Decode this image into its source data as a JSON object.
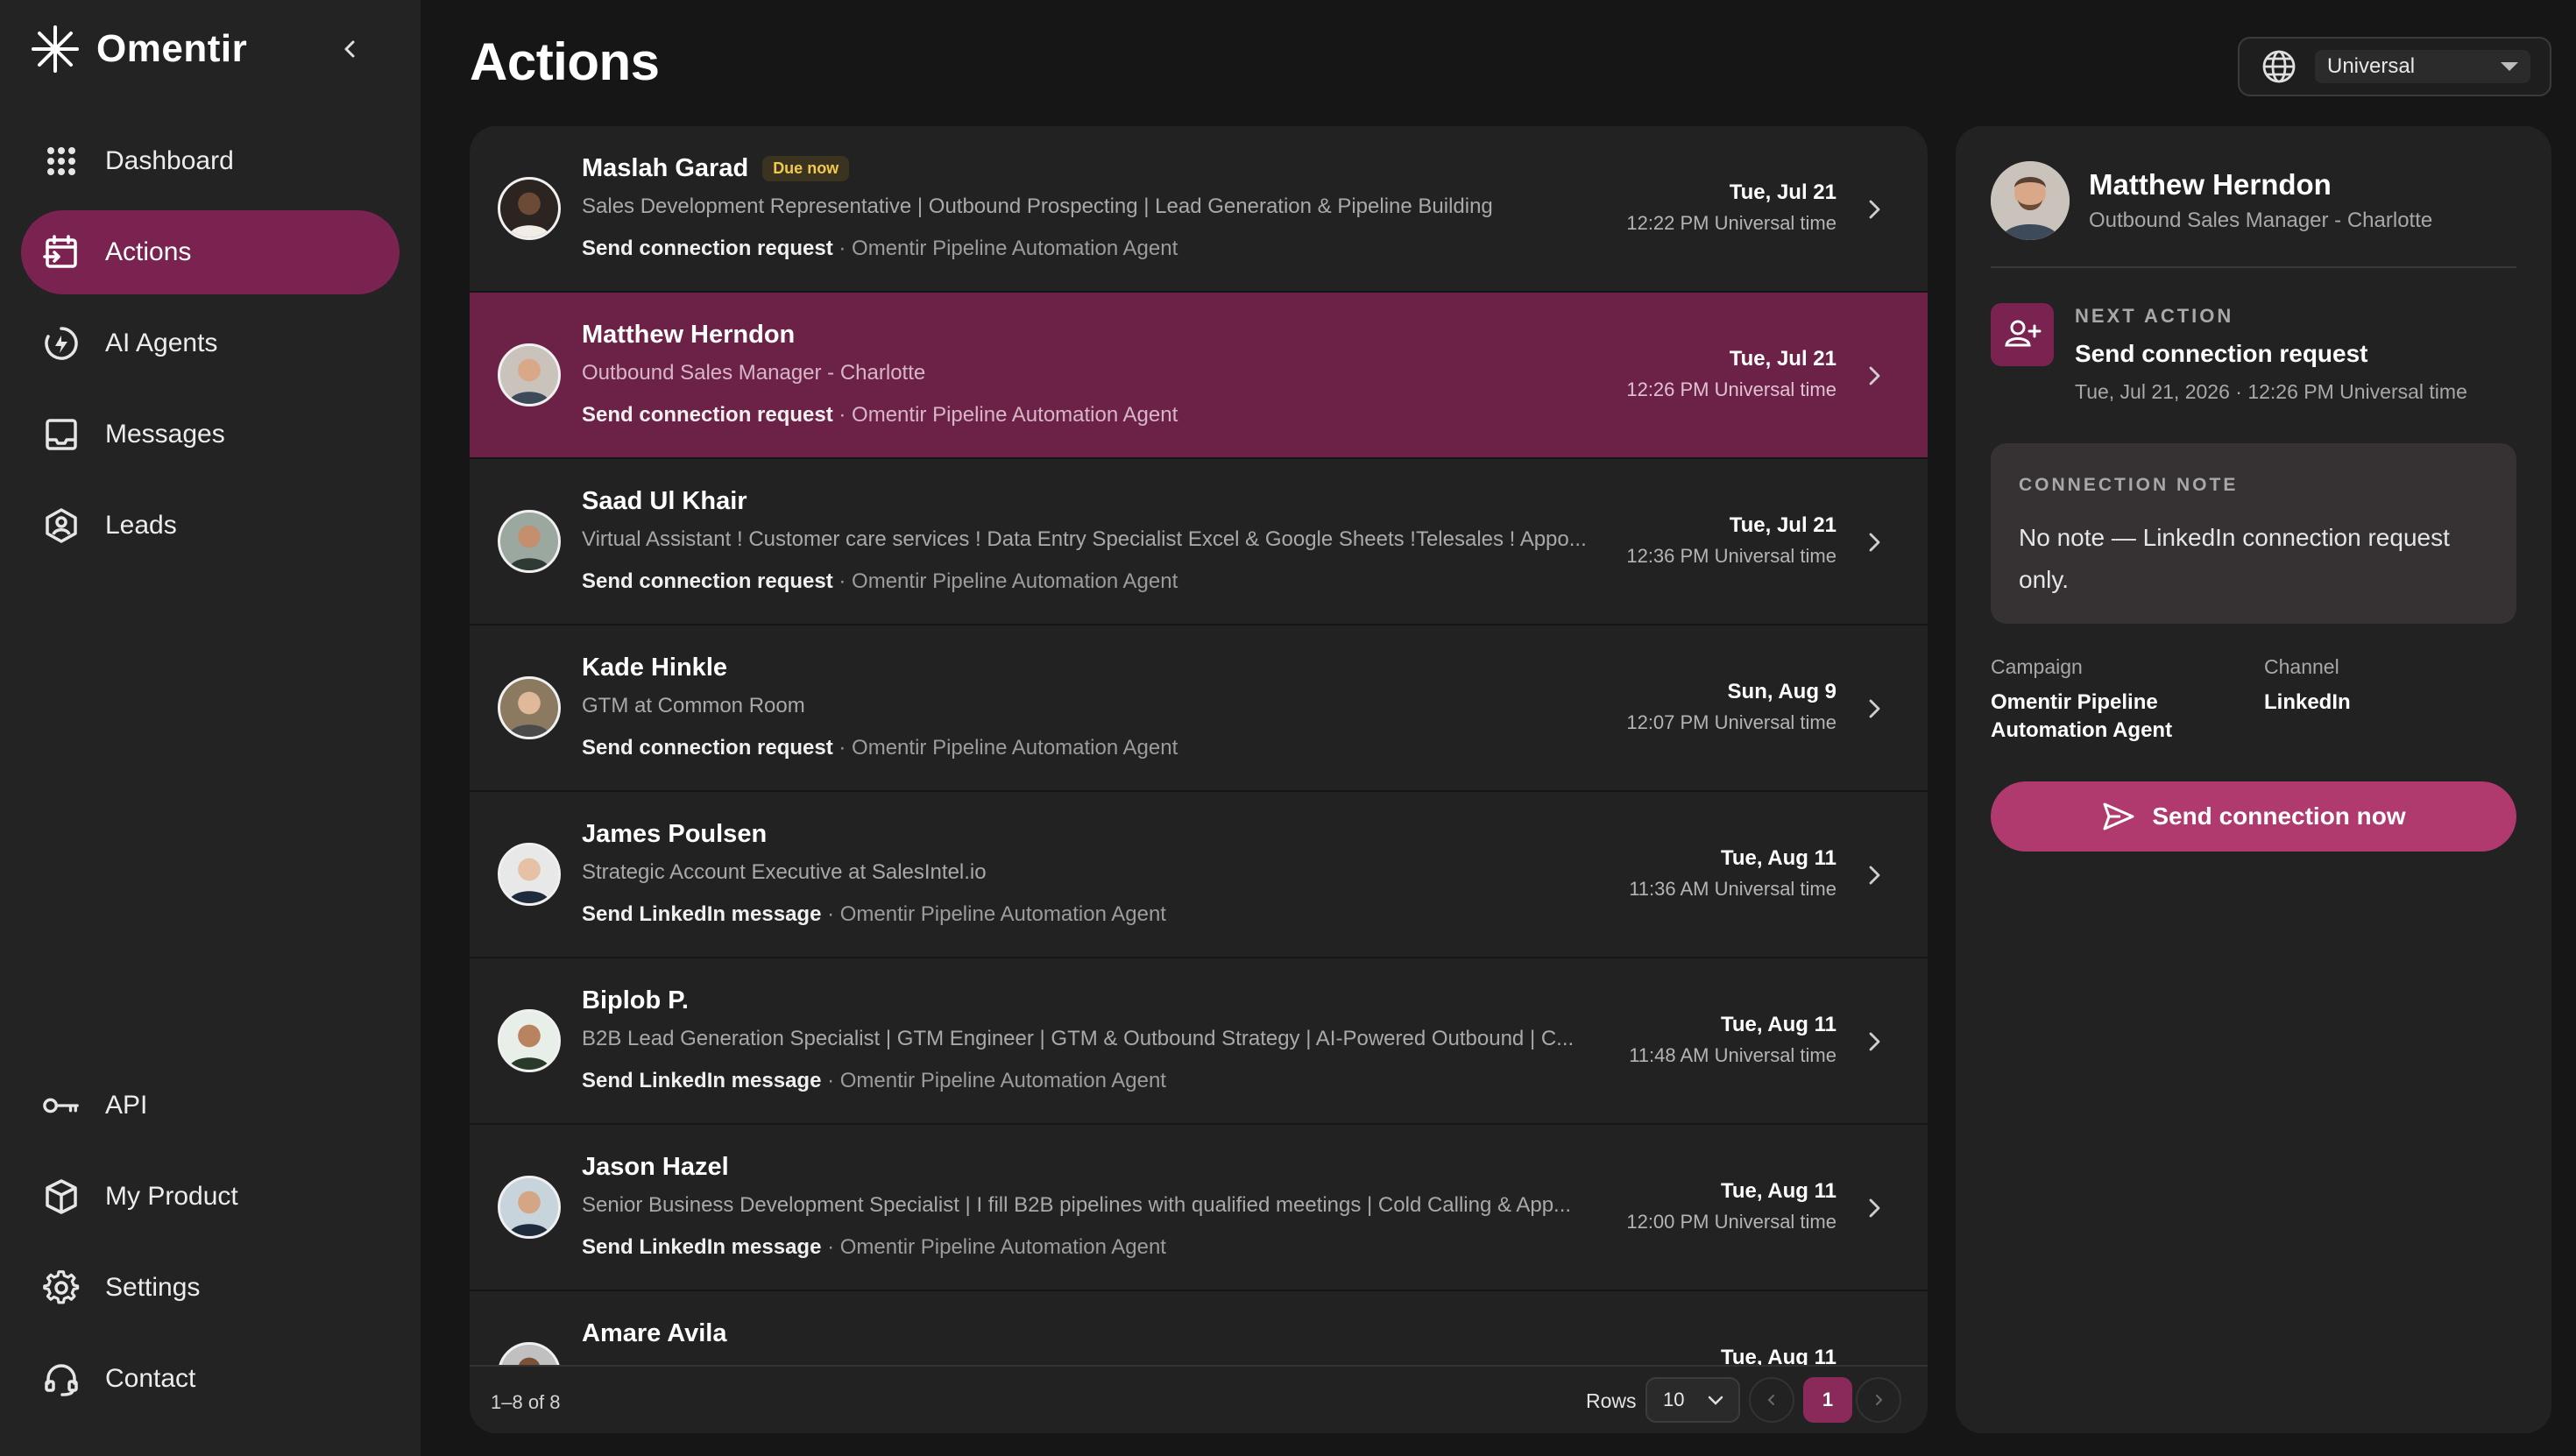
{
  "app": {
    "name": "Omentir"
  },
  "sidebar": {
    "items": [
      {
        "label": "Dashboard",
        "icon": "grid-icon"
      },
      {
        "label": "Actions",
        "icon": "calendar-action-icon",
        "active": true
      },
      {
        "label": "AI Agents",
        "icon": "agent-icon"
      },
      {
        "label": "Messages",
        "icon": "inbox-icon"
      },
      {
        "label": "Leads",
        "icon": "leads-icon"
      }
    ],
    "bottom_items": [
      {
        "label": "API",
        "icon": "key-icon"
      },
      {
        "label": "My Product",
        "icon": "box-icon"
      },
      {
        "label": "Settings",
        "icon": "gear-icon"
      },
      {
        "label": "Contact",
        "icon": "headset-icon"
      }
    ]
  },
  "header": {
    "title": "Actions",
    "timezone": "Universal"
  },
  "rows": [
    {
      "name": "Maslah Garad",
      "badge": "Due now",
      "headline": "Sales Development Representative | Outbound Prospecting | Lead Generation & Pipeline Building",
      "action": "Send connection request",
      "agent": " · Omentir Pipeline Automation Agent",
      "date": "Tue, Jul 21",
      "time": "12:22 PM Universal time"
    },
    {
      "name": "Matthew Herndon",
      "badge": "",
      "headline": "Outbound Sales Manager - Charlotte",
      "action": "Send connection request",
      "agent": " · Omentir Pipeline Automation Agent",
      "date": "Tue, Jul 21",
      "time": "12:26 PM Universal time",
      "selected": true
    },
    {
      "name": "Saad Ul Khair",
      "badge": "",
      "headline": "Virtual Assistant ! Customer care services ! Data Entry Specialist Excel & Google Sheets !Telesales ! Appo...",
      "action": "Send connection request",
      "agent": " · Omentir Pipeline Automation Agent",
      "date": "Tue, Jul 21",
      "time": "12:36 PM Universal time"
    },
    {
      "name": "Kade Hinkle",
      "badge": "",
      "headline": "GTM at Common Room",
      "action": "Send connection request",
      "agent": " · Omentir Pipeline Automation Agent",
      "date": "Sun, Aug 9",
      "time": "12:07 PM Universal time"
    },
    {
      "name": "James Poulsen",
      "badge": "",
      "headline": "Strategic Account Executive at SalesIntel.io",
      "action": "Send LinkedIn message",
      "agent": " · Omentir Pipeline Automation Agent",
      "date": "Tue, Aug 11",
      "time": "11:36 AM Universal time"
    },
    {
      "name": "Biplob P.",
      "badge": "",
      "headline": "B2B Lead Generation Specialist | GTM Engineer | GTM & Outbound Strategy | AI-Powered Outbound | C...",
      "action": "Send LinkedIn message",
      "agent": " · Omentir Pipeline Automation Agent",
      "date": "Tue, Aug 11",
      "time": "11:48 AM Universal time"
    },
    {
      "name": "Jason Hazel",
      "badge": "",
      "headline": "Senior Business Development Specialist | I fill B2B pipelines with qualified meetings | Cold Calling & App...",
      "action": "Send LinkedIn message",
      "agent": " · Omentir Pipeline Automation Agent",
      "date": "Tue, Aug 11",
      "time": "12:00 PM Universal time"
    },
    {
      "name": "Amare Avila",
      "badge": "",
      "headline": "",
      "action": "",
      "agent": "",
      "date": "Tue, Aug 11",
      "time": ""
    }
  ],
  "footer": {
    "range": "1–8 of 8",
    "rows_label": "Rows",
    "rows_value": "10",
    "page": "1"
  },
  "detail": {
    "name": "Matthew Herndon",
    "title": "Outbound Sales Manager - Charlotte",
    "next_action_label": "NEXT ACTION",
    "next_action": "Send connection request",
    "next_action_when": "Tue, Jul 21, 2026 · 12:26 PM Universal time",
    "note_label": "CONNECTION NOTE",
    "note_text": "No note — LinkedIn connection request only.",
    "campaign_label": "Campaign",
    "campaign_value": "Omentir Pipeline Automation Agent",
    "channel_label": "Channel",
    "channel_value": "LinkedIn",
    "send_button": "Send connection now"
  },
  "colors": {
    "accent": "#7a2351",
    "button": "#b0396e",
    "badge_text": "#f2c94c"
  }
}
